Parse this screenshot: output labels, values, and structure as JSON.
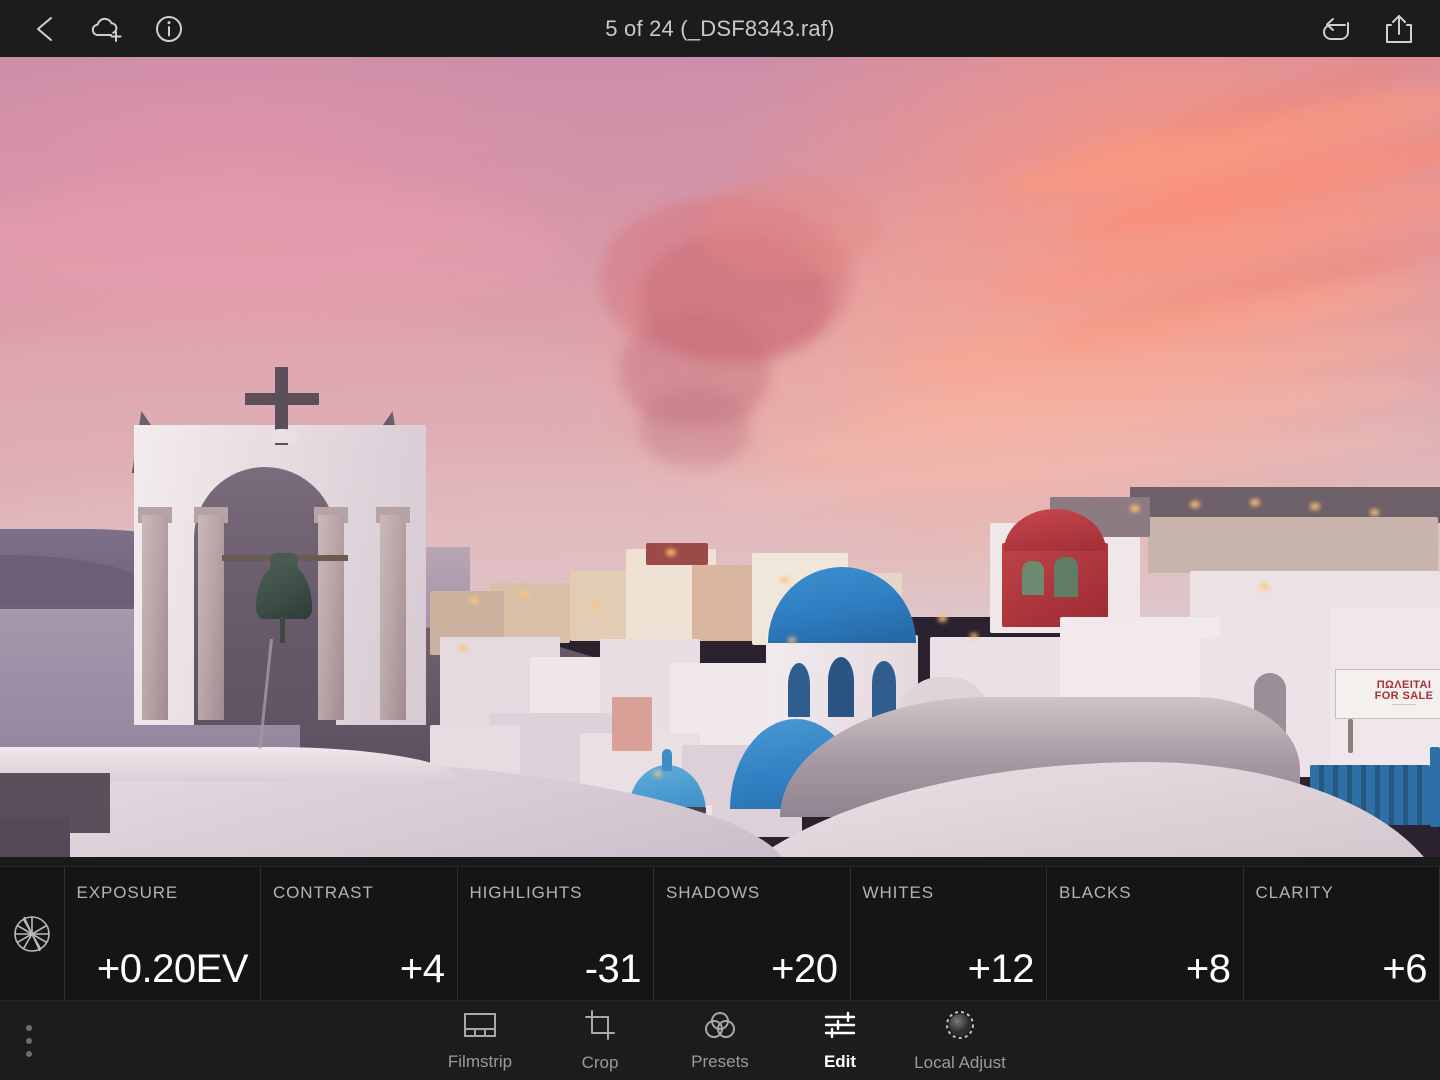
{
  "topbar": {
    "back_icon": "chevron-left-icon",
    "cloud_icon": "cloud-upload-icon",
    "info_icon": "info-icon",
    "title": "5 of 24 (_DSF8343.raf)",
    "undo_icon": "undo-icon",
    "share_icon": "share-icon"
  },
  "photo": {
    "description": "Sunset over Oia, Santorini: whitewashed bell tower with cross and bronze bell in foreground, blue-domed churches and cliffside village, pink and coral sky",
    "sign_text_greek": "ΠΩΛΕΙΤΑΙ",
    "sign_text_english": "FOR SALE"
  },
  "panel": {
    "aperture_icon": "aperture-icon",
    "adjustments": [
      {
        "label": "EXPOSURE",
        "value": "+0.20EV"
      },
      {
        "label": "CONTRAST",
        "value": "+4"
      },
      {
        "label": "HIGHLIGHTS",
        "value": "-31"
      },
      {
        "label": "SHADOWS",
        "value": "+20"
      },
      {
        "label": "WHITES",
        "value": "+12"
      },
      {
        "label": "BLACKS",
        "value": "+8"
      },
      {
        "label": "CLARITY",
        "value": "+6"
      }
    ]
  },
  "bottombar": {
    "overflow_icon": "more-vertical-icon",
    "tabs": [
      {
        "label": "Filmstrip",
        "icon": "filmstrip-icon",
        "active": false
      },
      {
        "label": "Crop",
        "icon": "crop-icon",
        "active": false
      },
      {
        "label": "Presets",
        "icon": "presets-icon",
        "active": false
      },
      {
        "label": "Edit",
        "icon": "sliders-icon",
        "active": true
      },
      {
        "label": "Local Adjust",
        "icon": "local-adjust-icon",
        "active": false
      }
    ]
  },
  "colors": {
    "chrome_bg": "#1c1c1c",
    "panel_bg": "#151515",
    "divider": "#2e2e2e",
    "text_primary": "#ffffff",
    "text_secondary": "#b3b3b3",
    "text_muted": "#9a9a9a",
    "dome_blue": "#2f7ec2",
    "red_building": "#b1343a",
    "gate_blue": "#2f6fa8"
  }
}
